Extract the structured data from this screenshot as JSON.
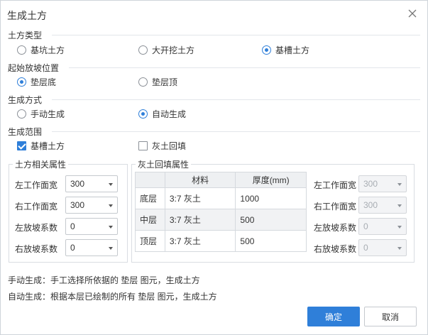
{
  "dialog": {
    "title": "生成土方"
  },
  "earthwork_type": {
    "label": "土方类型",
    "options": [
      {
        "label": "基坑土方",
        "checked": false
      },
      {
        "label": "大开挖土方",
        "checked": false
      },
      {
        "label": "基槽土方",
        "checked": true
      }
    ]
  },
  "slope_start": {
    "label": "起始放坡位置",
    "options": [
      {
        "label": "垫层底",
        "checked": true
      },
      {
        "label": "垫层顶",
        "checked": false
      }
    ]
  },
  "generate_mode": {
    "label": "生成方式",
    "options": [
      {
        "label": "手动生成",
        "checked": false
      },
      {
        "label": "自动生成",
        "checked": true
      }
    ]
  },
  "scope": {
    "label": "生成范围",
    "options": [
      {
        "label": "基槽土方",
        "checked": true
      },
      {
        "label": "灰土回填",
        "checked": false
      }
    ]
  },
  "earth_props": {
    "title": "土方相关属性",
    "fields": [
      {
        "label": "左工作面宽",
        "value": "300"
      },
      {
        "label": "右工作面宽",
        "value": "300"
      },
      {
        "label": "左放坡系数",
        "value": "0"
      },
      {
        "label": "右放坡系数",
        "value": "0"
      }
    ]
  },
  "fill_props": {
    "title": "灰土回填属性",
    "table": {
      "headers": [
        "",
        "材料",
        "厚度(mm)"
      ],
      "rows": [
        [
          "底层",
          "3:7 灰土",
          "1000"
        ],
        [
          "中层",
          "3:7 灰土",
          "500"
        ],
        [
          "顶层",
          "3:7 灰土",
          "500"
        ]
      ]
    },
    "fields": [
      {
        "label": "左工作面宽",
        "value": "300"
      },
      {
        "label": "右工作面宽",
        "value": "300"
      },
      {
        "label": "左放坡系数",
        "value": "0"
      },
      {
        "label": "右放坡系数",
        "value": "0"
      }
    ]
  },
  "notes": {
    "manual": "手动生成：手工选择所依据的 垫层 图元，生成土方",
    "auto": "自动生成：根据本层已绘制的所有 垫层 图元，生成土方"
  },
  "buttons": {
    "ok": "确定",
    "cancel": "取消"
  },
  "colors": {
    "accent": "#2f7fd9"
  }
}
